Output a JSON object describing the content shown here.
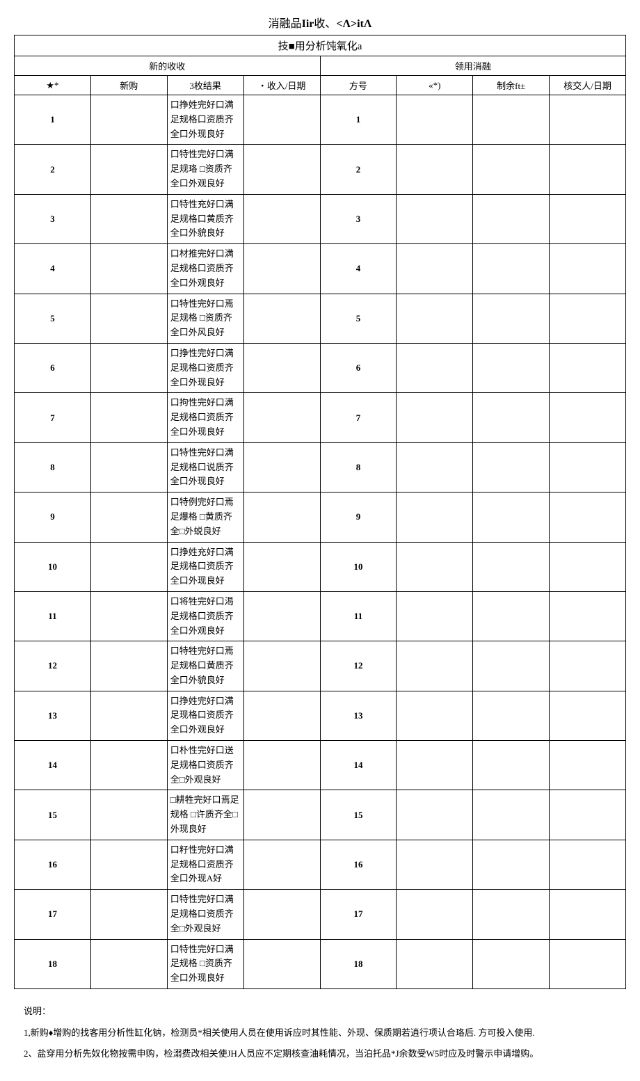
{
  "title_prefix": "消融品",
  "title_bold1": "Iir",
  "title_mid": "收、",
  "title_bold2": "<Λ>itΛ",
  "subtitle_prefix": "技",
  "subtitle_rest": "用分析饨氧化a",
  "section_left": "新的收收",
  "section_right": "领用消融",
  "hdr_seq1": "★*",
  "hdr_new": "新购",
  "hdr_result": "3枚结果",
  "hdr_date_in": "・收入/日期",
  "hdr_seq2": "方号",
  "hdr_qty": "«*)",
  "hdr_remain": "制余ft±",
  "hdr_sign": "核交人/日期",
  "rows": [
    {
      "n": "1",
      "r": "口挣姓完好口满足规格口资质齐全口外现良好"
    },
    {
      "n": "2",
      "r": "口特性完好口满足规珞 □资质齐全口外观良好"
    },
    {
      "n": "3",
      "r": "口特性充好口满足规格口黄质齐全口外貌良好"
    },
    {
      "n": "4",
      "r": "口材推完好口满足规格口资质齐全口外观良好"
    },
    {
      "n": "5",
      "r": "口特性完好口焉足规格 □资质齐全口外风良好"
    },
    {
      "n": "6",
      "r": "口挣性完好口满足现格口资质齐全口外现良好"
    },
    {
      "n": "7",
      "r": "口拘性完好口满足规格口资质齐全口外现良好"
    },
    {
      "n": "8",
      "r": "口特性完好口满足规格口说质齐全口外现良好"
    },
    {
      "n": "9",
      "r": "口特例完好口焉足爆格 □黄质齐全□外蜕良好"
    },
    {
      "n": "10",
      "r": "口挣姓充好口满足规格口资质齐全口外现良好"
    },
    {
      "n": "11",
      "r": "口将牲完好口渴足规格口资质齐全口外观良好"
    },
    {
      "n": "12",
      "r": "口特牲完好口焉足规格口黄质齐全口外貌良好"
    },
    {
      "n": "13",
      "r": "口挣姓完好口满足现格口资质齐全口外观良好"
    },
    {
      "n": "14",
      "r": "口朴性完好口送足规格口资质齐全□外观良好"
    },
    {
      "n": "15",
      "r": "□耕牲完好口焉足规格 □许质齐全□外现良好"
    },
    {
      "n": "16",
      "r": "口籽性完好口满足规格口资质齐全口外现A好"
    },
    {
      "n": "17",
      "r": "口特性完好口满足规格口资质齐全□外观良好"
    },
    {
      "n": "18",
      "r": "口特性完好口满足规格 □资质齐全口外现良好"
    }
  ],
  "note_head": "说明：",
  "note1": "1,新购♦增购的找客用分析性缸化钠，检测员*相关使用人员在使用诉应时其性能、外现、保质期若逍行项认合珞后. 方可投入使用.",
  "note2": "2、盐穿用分析先奴化物按需申购，检溺费改相关使JH人员应不定期核查油耗情况，当泊托品*J余数受W5时应及时警示申请增购。"
}
